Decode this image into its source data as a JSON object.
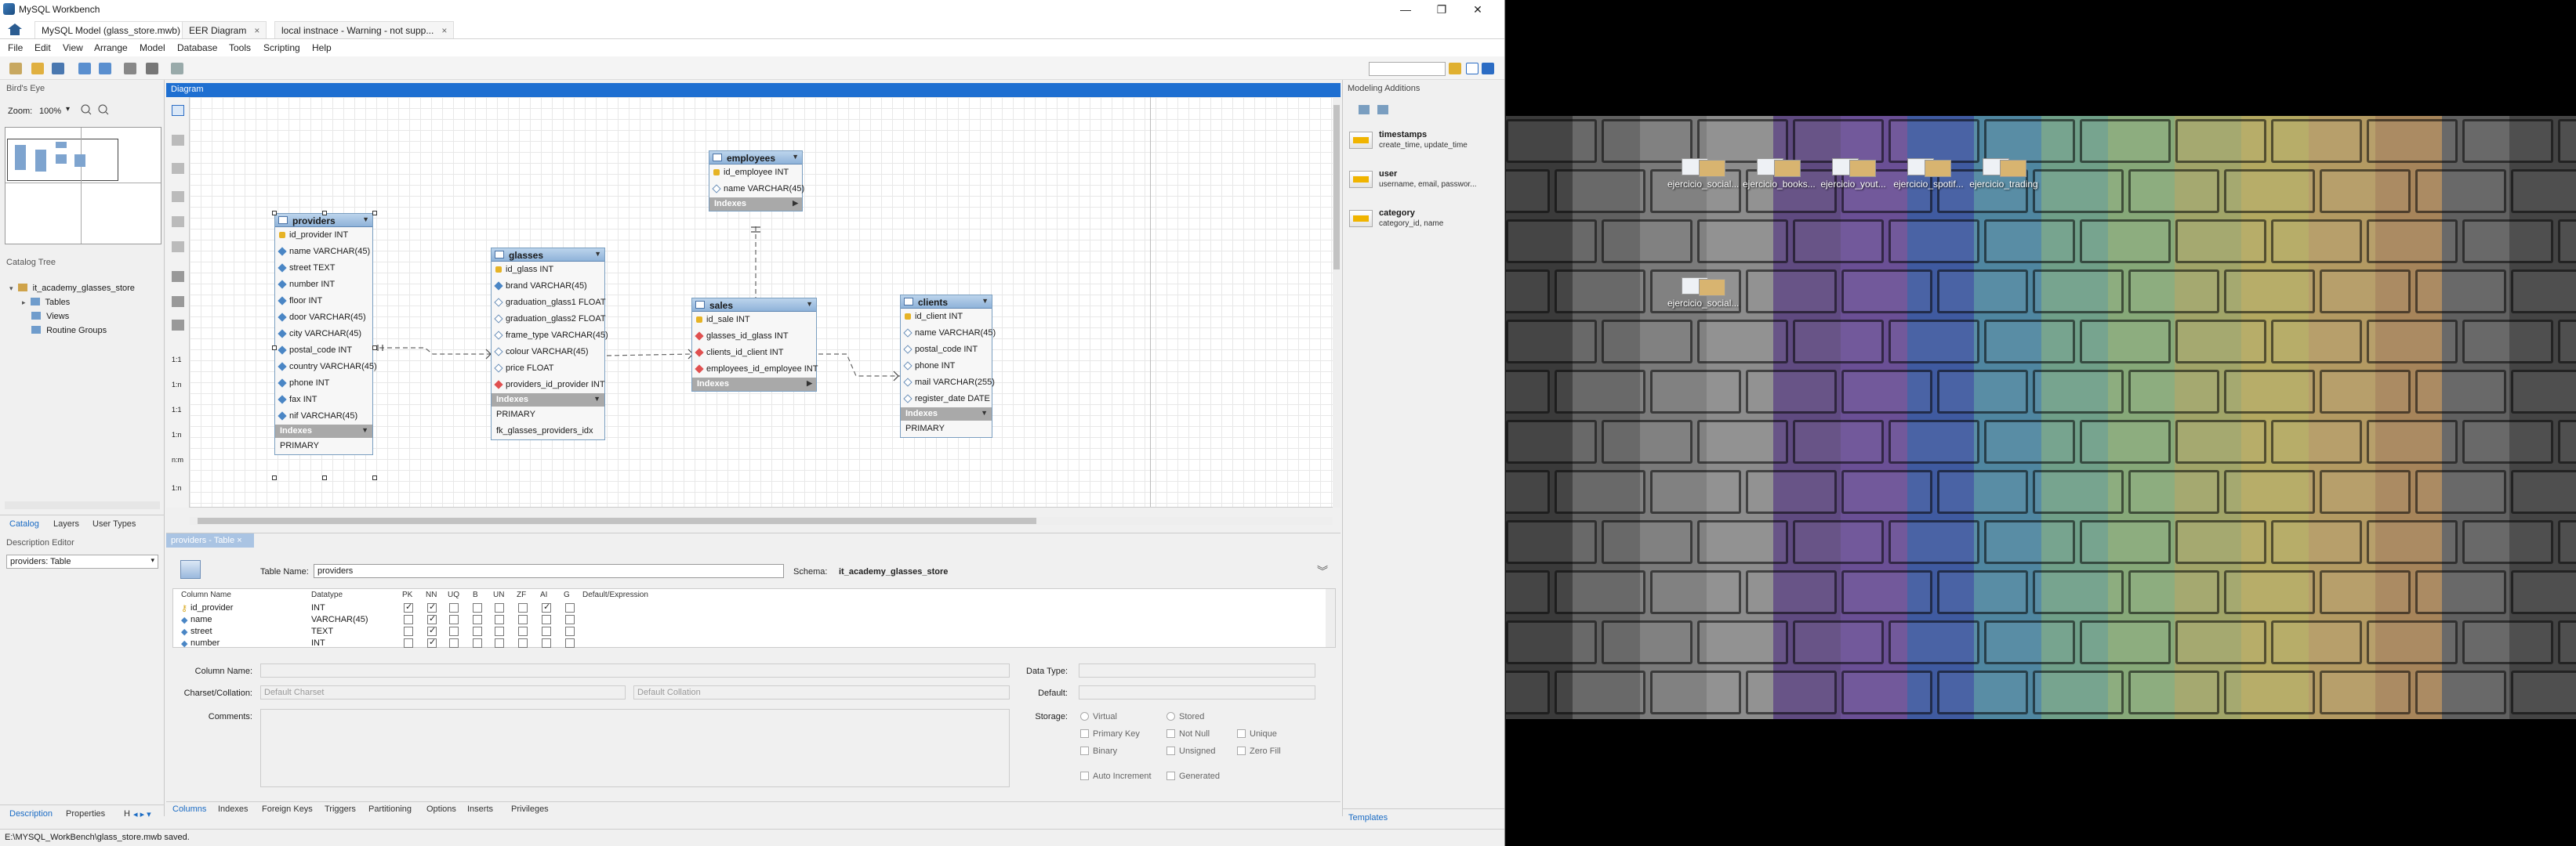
{
  "window": {
    "title": "MySQL Workbench",
    "tabs": [
      {
        "label": "MySQL Model (glass_store.mwb)",
        "close": "×"
      },
      {
        "label": "EER Diagram",
        "close": "×"
      },
      {
        "label": "local instnace - Warning - not supp...",
        "close": "×"
      }
    ],
    "controls": {
      "minimize": "—",
      "maximize": "❐",
      "close": "✕"
    }
  },
  "menu": [
    "File",
    "Edit",
    "View",
    "Arrange",
    "Model",
    "Database",
    "Tools",
    "Scripting",
    "Help"
  ],
  "left_panel": {
    "birds_eye_label": "Bird's Eye",
    "zoom_label": "Zoom:",
    "zoom_value": "100%",
    "catalog_tree_label": "Catalog Tree",
    "schema": "it_academy_glasses_store",
    "tree_items": [
      "Tables",
      "Views",
      "Routine Groups"
    ],
    "subtabs": [
      "Catalog",
      "Layers",
      "User Types"
    ],
    "description_editor_label": "Description Editor",
    "description_select": "providers: Table",
    "bottom_tabs": [
      "Description",
      "Properties",
      "H"
    ]
  },
  "diagram": {
    "header": "Diagram",
    "tables": {
      "employees": {
        "name": "employees",
        "columns": [
          {
            "name": "id_employee INT",
            "kind": "pk"
          },
          {
            "name": "name VARCHAR(45)",
            "kind": "n"
          }
        ],
        "indexes_label": "Indexes",
        "indexes": []
      },
      "providers": {
        "name": "providers",
        "columns": [
          {
            "name": "id_provider INT",
            "kind": "pk"
          },
          {
            "name": "name VARCHAR(45)",
            "kind": "nn"
          },
          {
            "name": "street TEXT",
            "kind": "nn"
          },
          {
            "name": "number INT",
            "kind": "nn"
          },
          {
            "name": "floor INT",
            "kind": "nn"
          },
          {
            "name": "door VARCHAR(45)",
            "kind": "nn"
          },
          {
            "name": "city VARCHAR(45)",
            "kind": "nn"
          },
          {
            "name": "postal_code INT",
            "kind": "nn"
          },
          {
            "name": "country VARCHAR(45)",
            "kind": "nn"
          },
          {
            "name": "phone INT",
            "kind": "nn"
          },
          {
            "name": "fax INT",
            "kind": "nn"
          },
          {
            "name": "nif VARCHAR(45)",
            "kind": "nn"
          }
        ],
        "indexes_label": "Indexes",
        "indexes": [
          "PRIMARY"
        ]
      },
      "glasses": {
        "name": "glasses",
        "columns": [
          {
            "name": "id_glass INT",
            "kind": "pk"
          },
          {
            "name": "brand VARCHAR(45)",
            "kind": "nn"
          },
          {
            "name": "graduation_glass1 FLOAT",
            "kind": "n"
          },
          {
            "name": "graduation_glass2 FLOAT",
            "kind": "n"
          },
          {
            "name": "frame_type VARCHAR(45)",
            "kind": "n"
          },
          {
            "name": "colour VARCHAR(45)",
            "kind": "n"
          },
          {
            "name": "price FLOAT",
            "kind": "n"
          },
          {
            "name": "providers_id_provider INT",
            "kind": "fk"
          }
        ],
        "indexes_label": "Indexes",
        "indexes": [
          "PRIMARY",
          "fk_glasses_providers_idx"
        ]
      },
      "sales": {
        "name": "sales",
        "columns": [
          {
            "name": "id_sale INT",
            "kind": "pk"
          },
          {
            "name": "glasses_id_glass INT",
            "kind": "fk"
          },
          {
            "name": "clients_id_client INT",
            "kind": "fk"
          },
          {
            "name": "employees_id_employee INT",
            "kind": "fk"
          }
        ],
        "indexes_label": "Indexes",
        "indexes": []
      },
      "clients": {
        "name": "clients",
        "columns": [
          {
            "name": "id_client INT",
            "kind": "pk"
          },
          {
            "name": "name VARCHAR(45)",
            "kind": "n"
          },
          {
            "name": "postal_code INT",
            "kind": "n"
          },
          {
            "name": "phone INT",
            "kind": "n"
          },
          {
            "name": "mail VARCHAR(255)",
            "kind": "n"
          },
          {
            "name": "register_date DATE",
            "kind": "n"
          }
        ],
        "indexes_label": "Indexes",
        "indexes": [
          "PRIMARY"
        ]
      }
    }
  },
  "modeling_additions": {
    "header": "Modeling Additions",
    "plugins": [
      {
        "name": "timestamps",
        "desc": "create_time, update_time"
      },
      {
        "name": "user",
        "desc": "username, email, passwor..."
      },
      {
        "name": "category",
        "desc": "category_id, name"
      }
    ],
    "bottom_tab": "Templates"
  },
  "editor": {
    "tab": "providers - Table",
    "table_name_label": "Table Name:",
    "table_name": "providers",
    "schema_label": "Schema:",
    "schema": "it_academy_glasses_store",
    "grid_headers": [
      "Column Name",
      "Datatype",
      "PK",
      "NN",
      "UQ",
      "B",
      "UN",
      "ZF",
      "AI",
      "G",
      "Default/Expression"
    ],
    "rows": [
      {
        "name": "id_provider",
        "type": "INT",
        "checks": [
          true,
          true,
          false,
          false,
          false,
          false,
          true,
          false
        ]
      },
      {
        "name": "name",
        "type": "VARCHAR(45)",
        "checks": [
          false,
          true,
          false,
          false,
          false,
          false,
          false,
          false
        ]
      },
      {
        "name": "street",
        "type": "TEXT",
        "checks": [
          false,
          true,
          false,
          false,
          false,
          false,
          false,
          false
        ]
      },
      {
        "name": "number",
        "type": "INT",
        "checks": [
          false,
          true,
          false,
          false,
          false,
          false,
          false,
          false
        ]
      }
    ],
    "column_name_label": "Column Name:",
    "charset_label": "Charset/Collation:",
    "charset_placeholder": "Default Charset",
    "collation_placeholder": "Default Collation",
    "comments_label": "Comments:",
    "data_type_label": "Data Type:",
    "default_label": "Default:",
    "storage_label": "Storage:",
    "storage_opts": [
      "Virtual",
      "Stored"
    ],
    "flags": [
      "Primary Key",
      "Not Null",
      "Unique",
      "Binary",
      "Unsigned",
      "Zero Fill",
      "Auto Increment",
      "Generated"
    ],
    "bottom_tabs": [
      "Columns",
      "Indexes",
      "Foreign Keys",
      "Triggers",
      "Partitioning",
      "Options",
      "Inserts",
      "Privileges"
    ]
  },
  "status": "E:\\MYSQL_WorkBench\\glass_store.mwb saved.",
  "desktop": {
    "icons": [
      "ejercicio_social...",
      "ejercicio_books...",
      "ejercicio_yout...",
      "ejercicio_spotif...",
      "ejercicio_trading",
      "ejercicio_social..."
    ],
    "stripe_colors": [
      "#3a3a3a",
      "#606060",
      "#7a7a7a",
      "#8c8c8c",
      "#5f4a80",
      "#6a4f95",
      "#3f5aa0",
      "#4f86a0",
      "#6f9f88",
      "#86a878",
      "#a0a468",
      "#b3a860",
      "#b39a62",
      "#a6845a",
      "#606060",
      "#444444"
    ]
  }
}
